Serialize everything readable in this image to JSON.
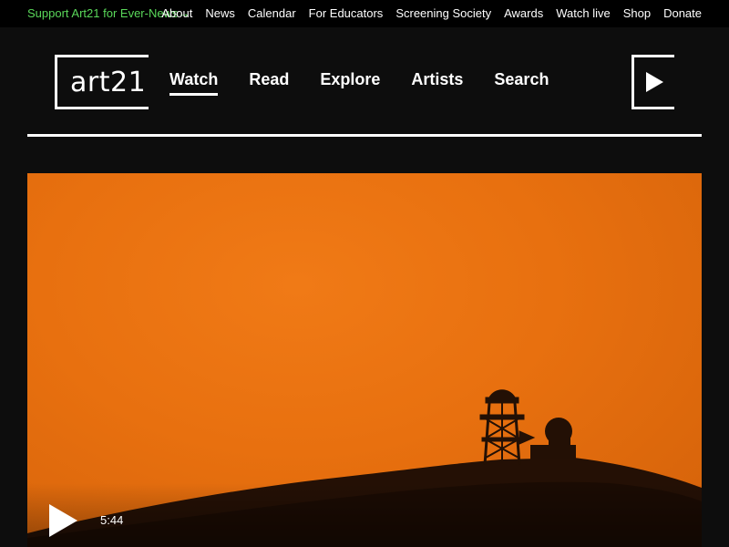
{
  "topbar": {
    "support_link": "Support Art21 for Ever-News→",
    "links": [
      "About",
      "News",
      "Calendar",
      "For Educators",
      "Screening Society",
      "Awards",
      "Watch live",
      "Shop",
      "Donate"
    ]
  },
  "header": {
    "logo_text": "art21",
    "nav": [
      "Watch",
      "Read",
      "Explore",
      "Artists",
      "Search"
    ],
    "active_nav": "Watch"
  },
  "hero": {
    "duration": "5:44",
    "accent_color": "#e8700f"
  },
  "colors": {
    "support_green": "#5ad85a",
    "background": "#0d0d0d"
  }
}
